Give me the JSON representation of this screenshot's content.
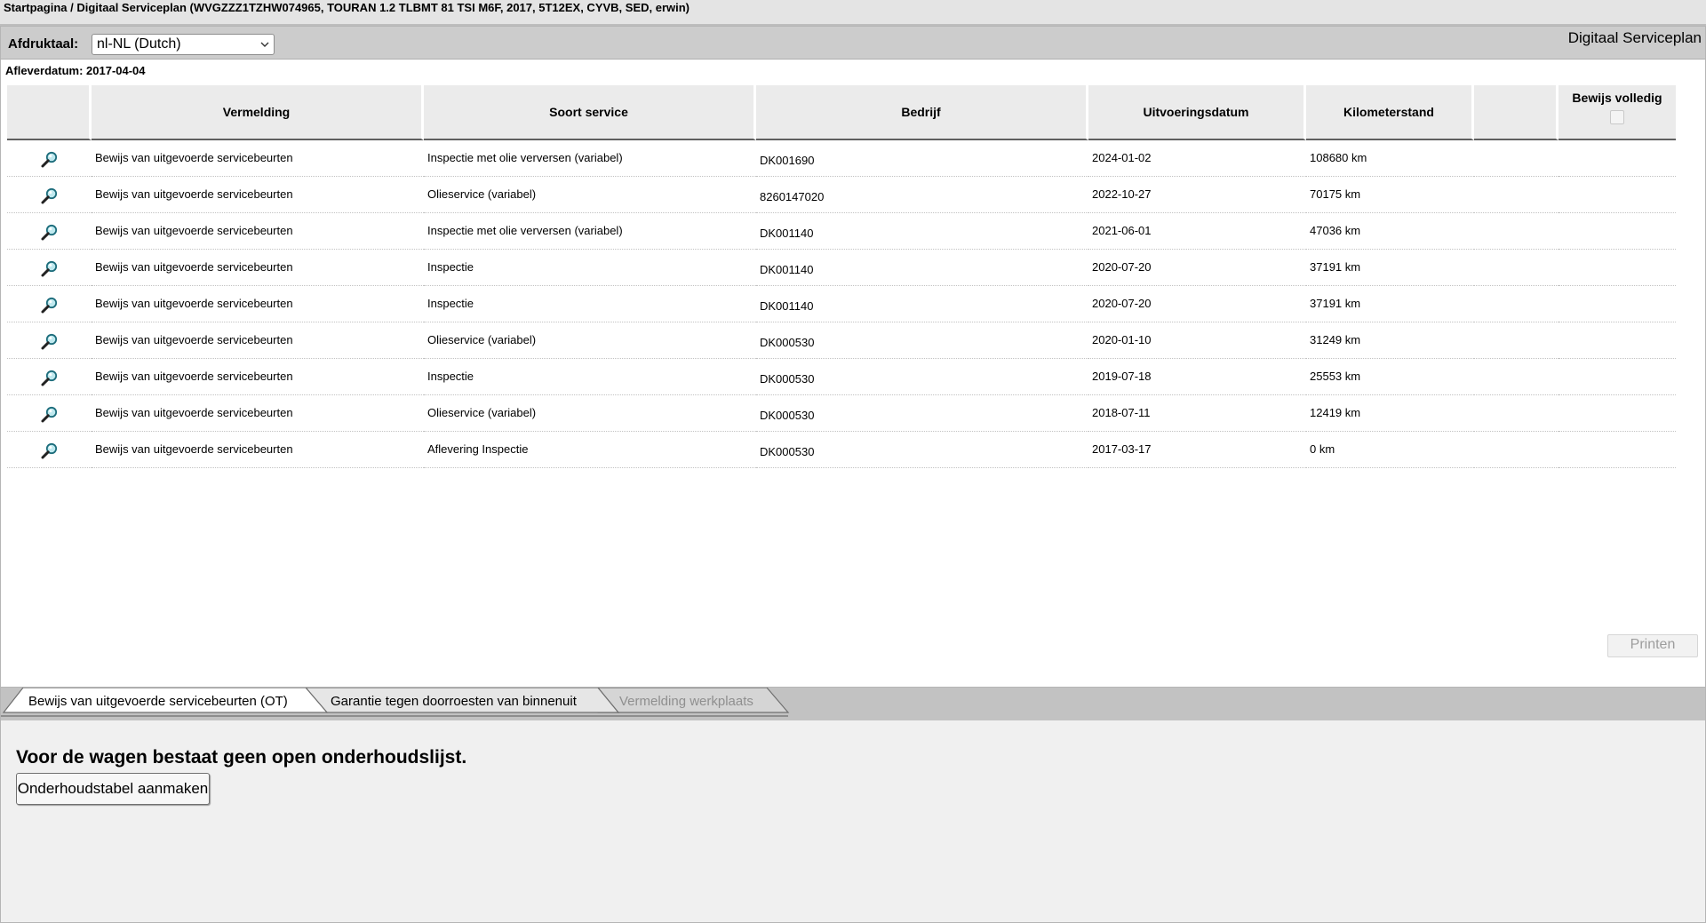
{
  "breadcrumb": "Startpagina / Digitaal Serviceplan (WVGZZZ1TZHW074965, TOURAN 1.2 TLBMT 81 TSI M6F, 2017, 5T12EX, CYVB, SED, erwin)",
  "toolbar": {
    "language_label": "Afdruktaal:",
    "language_value": "nl-NL (Dutch)",
    "app_title": "Digitaal Serviceplan"
  },
  "delivery": "Afleverdatum: 2017-04-04",
  "table": {
    "headers": [
      "Vermelding",
      "Soort service",
      "Bedrijf",
      "Uitvoeringsdatum",
      "Kilometerstand",
      "",
      "Bewijs volledig"
    ],
    "rows": [
      {
        "vermelding": "Bewijs van uitgevoerde servicebeurten",
        "soort": "Inspectie met olie verversen (variabel)",
        "bedrijf": "DK001690",
        "datum": "2024-01-02",
        "km": "108680 km"
      },
      {
        "vermelding": "Bewijs van uitgevoerde servicebeurten",
        "soort": "Olieservice (variabel)",
        "bedrijf": "8260147020",
        "datum": "2022-10-27",
        "km": "70175 km"
      },
      {
        "vermelding": "Bewijs van uitgevoerde servicebeurten",
        "soort": "Inspectie met olie verversen (variabel)",
        "bedrijf": "DK001140",
        "datum": "2021-06-01",
        "km": "47036 km"
      },
      {
        "vermelding": "Bewijs van uitgevoerde servicebeurten",
        "soort": "Inspectie",
        "bedrijf": "DK001140",
        "datum": "2020-07-20",
        "km": "37191 km"
      },
      {
        "vermelding": "Bewijs van uitgevoerde servicebeurten",
        "soort": "Inspectie",
        "bedrijf": "DK001140",
        "datum": "2020-07-20",
        "km": "37191 km"
      },
      {
        "vermelding": "Bewijs van uitgevoerde servicebeurten",
        "soort": "Olieservice (variabel)",
        "bedrijf": "DK000530",
        "datum": "2020-01-10",
        "km": "31249 km"
      },
      {
        "vermelding": "Bewijs van uitgevoerde servicebeurten",
        "soort": "Inspectie",
        "bedrijf": "DK000530",
        "datum": "2019-07-18",
        "km": "25553 km"
      },
      {
        "vermelding": "Bewijs van uitgevoerde servicebeurten",
        "soort": "Olieservice (variabel)",
        "bedrijf": "DK000530",
        "datum": "2018-07-11",
        "km": "12419 km"
      },
      {
        "vermelding": "Bewijs van uitgevoerde servicebeurten",
        "soort": "Aflevering Inspectie",
        "bedrijf": "DK000530",
        "datum": "2017-03-17",
        "km": "0 km"
      }
    ]
  },
  "print_button": "Printen",
  "tabs": [
    {
      "label": "Bewijs van uitgevoerde servicebeurten (OT)",
      "state": "active"
    },
    {
      "label": "Garantie tegen doorroesten van binnenuit",
      "state": "normal"
    },
    {
      "label": "Vermelding werkplaats",
      "state": "disabled"
    }
  ],
  "lower": {
    "message": "Voor de wagen bestaat geen open onderhoudslijst.",
    "create_button": "Onderhoudstabel aanmaken"
  },
  "colors": {
    "tab_active_bg": "#ffffff",
    "tab_normal_bg": "#e6e6e6",
    "tab_disabled_text": "#8f8f8f",
    "tabbar_bg": "#c2c2c2"
  }
}
